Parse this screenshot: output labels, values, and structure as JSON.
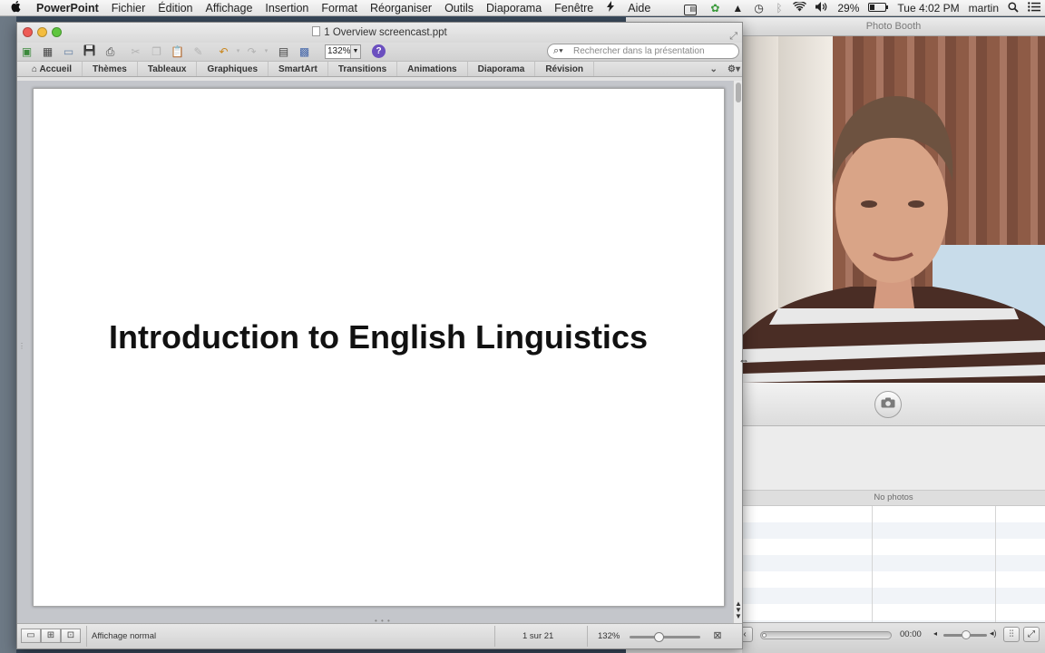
{
  "menubar": {
    "apple": "",
    "app_name": "PowerPoint",
    "items": [
      "Fichier",
      "Édition",
      "Affichage",
      "Insertion",
      "Format",
      "Réorganiser",
      "Outils",
      "Diaporama",
      "Fenêtre",
      "",
      "Aide"
    ],
    "battery": "29%",
    "clock": "Tue 4:02 PM",
    "user": "martin",
    "search_glyph": "⌕"
  },
  "powerpoint": {
    "window_title": "1 Overview screencast.ppt",
    "toolbar": {
      "zoom_value": "132%",
      "help_label": "?",
      "search_placeholder": "Rechercher dans la présentation"
    },
    "ribbon_tabs": [
      "Accueil",
      "Thèmes",
      "Tableaux",
      "Graphiques",
      "SmartArt",
      "Transitions",
      "Animations",
      "Diaporama",
      "Révision"
    ],
    "slide": {
      "title": "Introduction to English Linguistics"
    },
    "status": {
      "view_label": "Affichage normal",
      "page_label": "1 sur 21",
      "zoom_label": "132%",
      "zoom_slider_fraction": 0.4
    }
  },
  "photobooth": {
    "window_title": "Photo Booth",
    "no_photos_label": "No photos",
    "time_label": "00:00"
  },
  "colors": {
    "close": "#ee5b55",
    "minimize": "#f4bd3f",
    "zoom": "#5fc63f",
    "help": "#6b4fbf"
  }
}
